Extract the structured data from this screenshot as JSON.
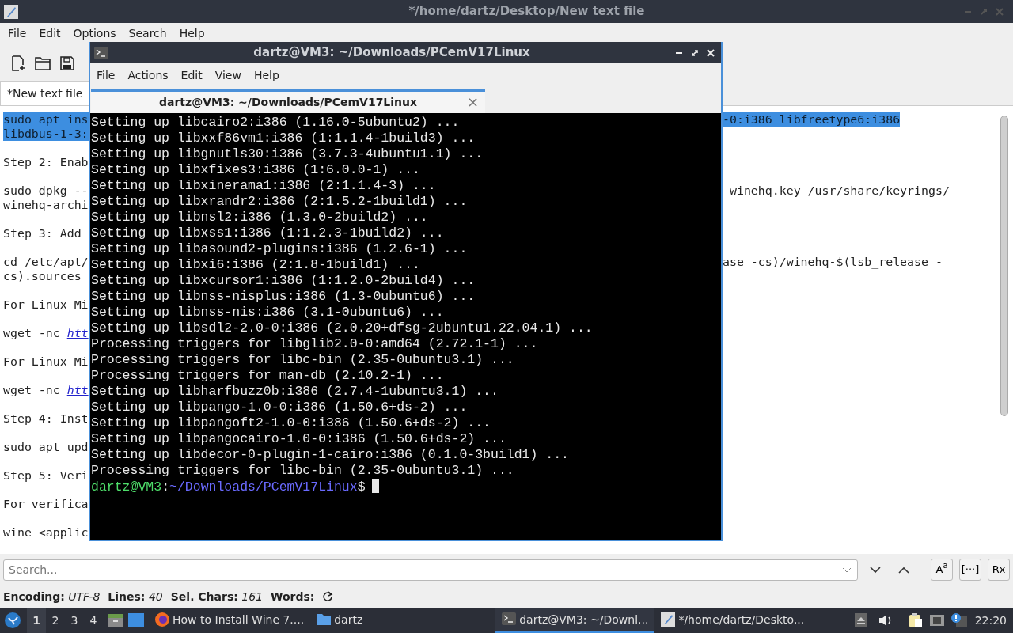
{
  "editor": {
    "title": "*/home/dartz/Desktop/New text file",
    "menu": [
      "File",
      "Edit",
      "Options",
      "Search",
      "Help"
    ],
    "tabs": [
      {
        "label": "*New text file",
        "selected": true
      }
    ],
    "lines": [
      {
        "kind": "text",
        "left": "sudo apt ins",
        "right": "-0:i386 libfreetype6:i386",
        "selected": true
      },
      {
        "kind": "text",
        "left": "libdbus-1-3:",
        "selected": true
      },
      {
        "kind": "blank"
      },
      {
        "kind": "text",
        "left": "Step 2: Enab",
        "selected": false
      },
      {
        "kind": "blank"
      },
      {
        "kind": "text",
        "left": "sudo dpkg --",
        "right": " winehq.key /usr/share/keyrings/",
        "selected": false
      },
      {
        "kind": "text",
        "left": "winehq-archi",
        "selected": false
      },
      {
        "kind": "blank"
      },
      {
        "kind": "text",
        "left": "Step 3: Add",
        "selected": false
      },
      {
        "kind": "blank"
      },
      {
        "kind": "text",
        "left": "cd /etc/apt/",
        "right": "ase -cs)/winehq-$(lsb_release -",
        "selected": false
      },
      {
        "kind": "text",
        "left": "cs).sources",
        "selected": false
      },
      {
        "kind": "blank"
      },
      {
        "kind": "text",
        "left": "For Linux Mi",
        "selected": false
      },
      {
        "kind": "blank"
      },
      {
        "kind": "text",
        "left": "wget -nc ",
        "link": "htt",
        "selected": false
      },
      {
        "kind": "blank"
      },
      {
        "kind": "text",
        "left": "For Linux Mi",
        "selected": false
      },
      {
        "kind": "blank"
      },
      {
        "kind": "text",
        "left": "wget -nc ",
        "link": "htt",
        "selected": false
      },
      {
        "kind": "blank"
      },
      {
        "kind": "text",
        "left": "Step 4: Inst",
        "selected": false
      },
      {
        "kind": "blank"
      },
      {
        "kind": "text",
        "left": "sudo apt upd",
        "selected": false
      },
      {
        "kind": "blank"
      },
      {
        "kind": "text",
        "left": "Step 5: Veri",
        "selected": false
      },
      {
        "kind": "blank"
      },
      {
        "kind": "text",
        "left": "For verifica",
        "selected": false
      },
      {
        "kind": "blank"
      },
      {
        "kind": "text",
        "left": "wine <applic",
        "selected": false
      }
    ],
    "search": {
      "placeholder": "Search...",
      "toggles": [
        "A$^{a}$",
        "[···]",
        "Rx"
      ]
    },
    "status": [
      {
        "label": "Encoding:",
        "value": "UTF-8"
      },
      {
        "label": "Lines:",
        "value": "40"
      },
      {
        "label": "Sel. Chars:",
        "value": "161"
      },
      {
        "label": "Words:"
      }
    ]
  },
  "terminal": {
    "title": "dartz@VM3: ~/Downloads/PCemV17Linux",
    "menu": [
      "File",
      "Actions",
      "Edit",
      "View",
      "Help"
    ],
    "tabs": [
      {
        "label": "dartz@VM3: ~/Downloads/PCemV17Linux",
        "selected": true
      }
    ],
    "tab_close": "×",
    "output": [
      "Setting up libcairo2:i386 (1.16.0-5ubuntu2) ...",
      "Setting up libxxf86vm1:i386 (1:1.1.4-1build3) ...",
      "Setting up libgnutls30:i386 (3.7.3-4ubuntu1.1) ...",
      "Setting up libxfixes3:i386 (1:6.0.0-1) ...",
      "Setting up libxinerama1:i386 (2:1.1.4-3) ...",
      "Setting up libxrandr2:i386 (2:1.5.2-1build1) ...",
      "Setting up libnsl2:i386 (1.3.0-2build2) ...",
      "Setting up libxss1:i386 (1:1.2.3-1build2) ...",
      "Setting up libasound2-plugins:i386 (1.2.6-1) ...",
      "Setting up libxi6:i386 (2:1.8-1build1) ...",
      "Setting up libxcursor1:i386 (1:1.2.0-2build4) ...",
      "Setting up libnss-nisplus:i386 (1.3-0ubuntu6) ...",
      "Setting up libnss-nis:i386 (3.1-0ubuntu6) ...",
      "Setting up libsdl2-2.0-0:i386 (2.0.20+dfsg-2ubuntu1.22.04.1) ...",
      "Processing triggers for libglib2.0-0:amd64 (2.72.1-1) ...",
      "Processing triggers for libc-bin (2.35-0ubuntu3.1) ...",
      "Processing triggers for man-db (2.10.2-1) ...",
      "Setting up libharfbuzz0b:i386 (2.7.4-1ubuntu3.1) ...",
      "Setting up libpango-1.0-0:i386 (1.50.6+ds-2) ...",
      "Setting up libpangoft2-1.0-0:i386 (1.50.6+ds-2) ...",
      "Setting up libpangocairo-1.0-0:i386 (1.50.6+ds-2) ...",
      "Setting up libdecor-0-plugin-1-cairo:i386 (0.1.0-3build1) ...",
      "Processing triggers for libc-bin (2.35-0ubuntu3.1) ..."
    ],
    "prompt": {
      "user": "dartz@VM3",
      "sep": ":",
      "path": "~/Downloads/PCemV17Linux",
      "sign": "$"
    }
  },
  "taskbar": {
    "workspaces": [
      {
        "label": "1",
        "selected": true
      },
      {
        "label": "2",
        "selected": false
      },
      {
        "label": "3",
        "selected": false
      },
      {
        "label": "4",
        "selected": false
      }
    ],
    "tasks": [
      {
        "kind": "browser",
        "label": "How to Install Wine 7....",
        "selected": false
      },
      {
        "kind": "folder",
        "label": "dartz",
        "selected": false
      },
      {
        "kind": "terminal",
        "label": "dartz@VM3: ~/Downl...",
        "selected": true
      },
      {
        "kind": "editor",
        "label": "*/home/dartz/Deskto...",
        "selected": false
      }
    ],
    "clock": "22:20"
  }
}
